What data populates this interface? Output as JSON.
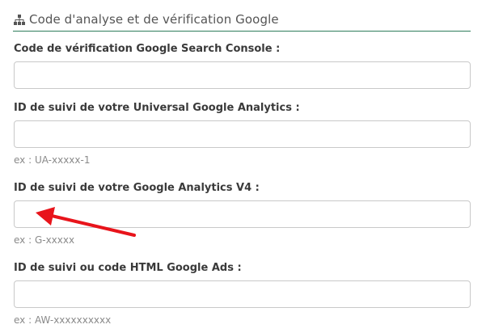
{
  "section": {
    "title": "Code d'analyse et de vérification Google",
    "icon": "sitemap-icon"
  },
  "fields": [
    {
      "label": "Code de vérification Google Search Console :",
      "value": "",
      "placeholder": "",
      "hint": ""
    },
    {
      "label": "ID de suivi de votre Universal Google Analytics :",
      "value": "",
      "placeholder": "",
      "hint": "ex : UA-xxxxx-1"
    },
    {
      "label": "ID de suivi de votre Google Analytics V4 :",
      "value": "",
      "placeholder": "",
      "hint": "ex : G-xxxxx"
    },
    {
      "label": "ID de suivi ou code HTML Google Ads :",
      "value": "",
      "placeholder": "",
      "hint": "ex : AW-xxxxxxxxxx"
    }
  ],
  "annotation": {
    "arrow_color": "#e8141b"
  }
}
